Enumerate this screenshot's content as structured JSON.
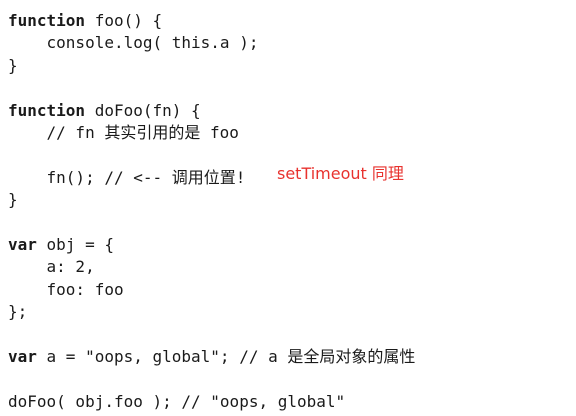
{
  "code_lines": [
    {
      "kw": "function",
      "text": " foo() {"
    },
    {
      "kw": "",
      "text": "    console.log( this.a );"
    },
    {
      "kw": "",
      "text": "}"
    },
    {
      "kw": "",
      "text": ""
    },
    {
      "kw": "function",
      "text": " doFoo(fn) {"
    },
    {
      "kw": "",
      "text": "    // fn 其实引用的是 foo"
    },
    {
      "kw": "",
      "text": ""
    },
    {
      "kw": "",
      "text": "    fn(); // <-- 调用位置!"
    },
    {
      "kw": "",
      "text": "}"
    },
    {
      "kw": "",
      "text": ""
    },
    {
      "kw": "var",
      "text": " obj = {"
    },
    {
      "kw": "",
      "text": "    a: 2,"
    },
    {
      "kw": "",
      "text": "    foo: foo"
    },
    {
      "kw": "",
      "text": "};"
    },
    {
      "kw": "",
      "text": ""
    },
    {
      "kw": "var",
      "text": " a = \"oops, global\"; // a 是全局对象的属性"
    },
    {
      "kw": "",
      "text": ""
    },
    {
      "kw": "",
      "text": "doFoo( obj.foo ); // \"oops, global\""
    }
  ],
  "annotation": {
    "text": "setTimeout 同理",
    "color": "#e8322e"
  }
}
